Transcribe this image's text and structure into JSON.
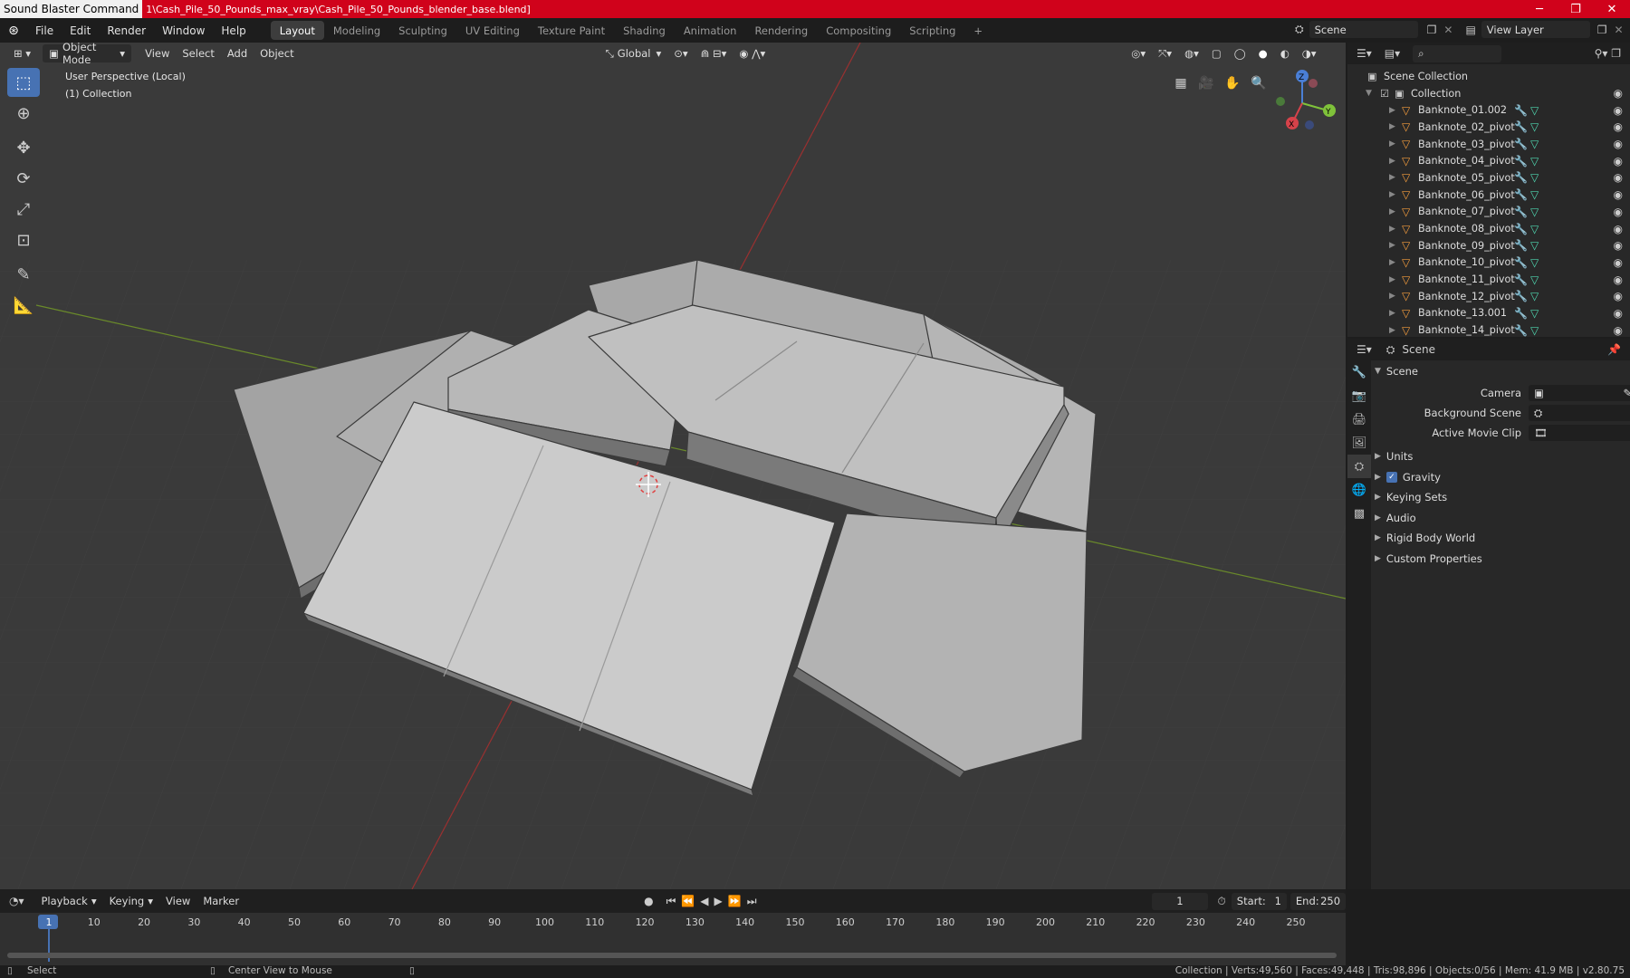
{
  "window": {
    "app_name": "Sound Blaster Command",
    "file_path": "1\\Cash_Pile_50_Pounds_max_vray\\Cash_Pile_50_Pounds_blender_base.blend]"
  },
  "menu": {
    "items": [
      "File",
      "Edit",
      "Render",
      "Window",
      "Help"
    ]
  },
  "workspaces": {
    "tabs": [
      "Layout",
      "Modeling",
      "Sculpting",
      "UV Editing",
      "Texture Paint",
      "Shading",
      "Animation",
      "Rendering",
      "Compositing",
      "Scripting"
    ],
    "active": "Layout",
    "add_symbol": "+"
  },
  "top_right": {
    "scene": "Scene",
    "view_layer": "View Layer"
  },
  "viewport_header": {
    "mode": "Object Mode",
    "menus": [
      "View",
      "Select",
      "Add",
      "Object"
    ],
    "transform": "Global"
  },
  "viewport": {
    "perspective": "User Perspective (Local)",
    "collection": "(1) Collection"
  },
  "gizmo": {
    "x": "X",
    "y": "Y",
    "z": "Z"
  },
  "outliner": {
    "root": "Scene Collection",
    "collection": "Collection",
    "items": [
      "Banknote_01.002",
      "Banknote_02_pivot",
      "Banknote_03_pivot",
      "Banknote_04_pivot",
      "Banknote_05_pivot",
      "Banknote_06_pivot",
      "Banknote_07_pivot",
      "Banknote_08_pivot",
      "Banknote_09_pivot",
      "Banknote_10_pivot",
      "Banknote_11_pivot",
      "Banknote_12_pivot",
      "Banknote_13.001",
      "Banknote_14_pivot"
    ]
  },
  "properties": {
    "header_title": "Scene",
    "panel_title": "Scene",
    "camera_label": "Camera",
    "background_label": "Background Scene",
    "movie_clip_label": "Active Movie Clip",
    "sections": [
      "Units",
      "Gravity",
      "Keying Sets",
      "Audio",
      "Rigid Body World",
      "Custom Properties"
    ],
    "gravity_checked": true
  },
  "timeline": {
    "menus": [
      "Playback",
      "Keying",
      "View",
      "Marker"
    ],
    "current_frame": "1",
    "start_label": "Start:",
    "start": "1",
    "end_label": "End:",
    "end": "250",
    "ticks": [
      "1",
      "10",
      "20",
      "30",
      "40",
      "50",
      "60",
      "70",
      "80",
      "90",
      "100",
      "110",
      "120",
      "130",
      "140",
      "150",
      "160",
      "170",
      "180",
      "190",
      "200",
      "210",
      "220",
      "230",
      "240",
      "250"
    ]
  },
  "status": {
    "left_action": "Select",
    "mid_action": "Center View to Mouse",
    "stats": "Collection | Verts:49,560 | Faces:49,448 | Tris:98,896 | Objects:0/56 | Mem: 41.9 MB | v2.80.75"
  },
  "colors": {
    "accent": "#4772b3",
    "titlebar": "#d0021b",
    "object_icon": "#f39c3d",
    "mesh_icon": "#4fd6b0"
  }
}
